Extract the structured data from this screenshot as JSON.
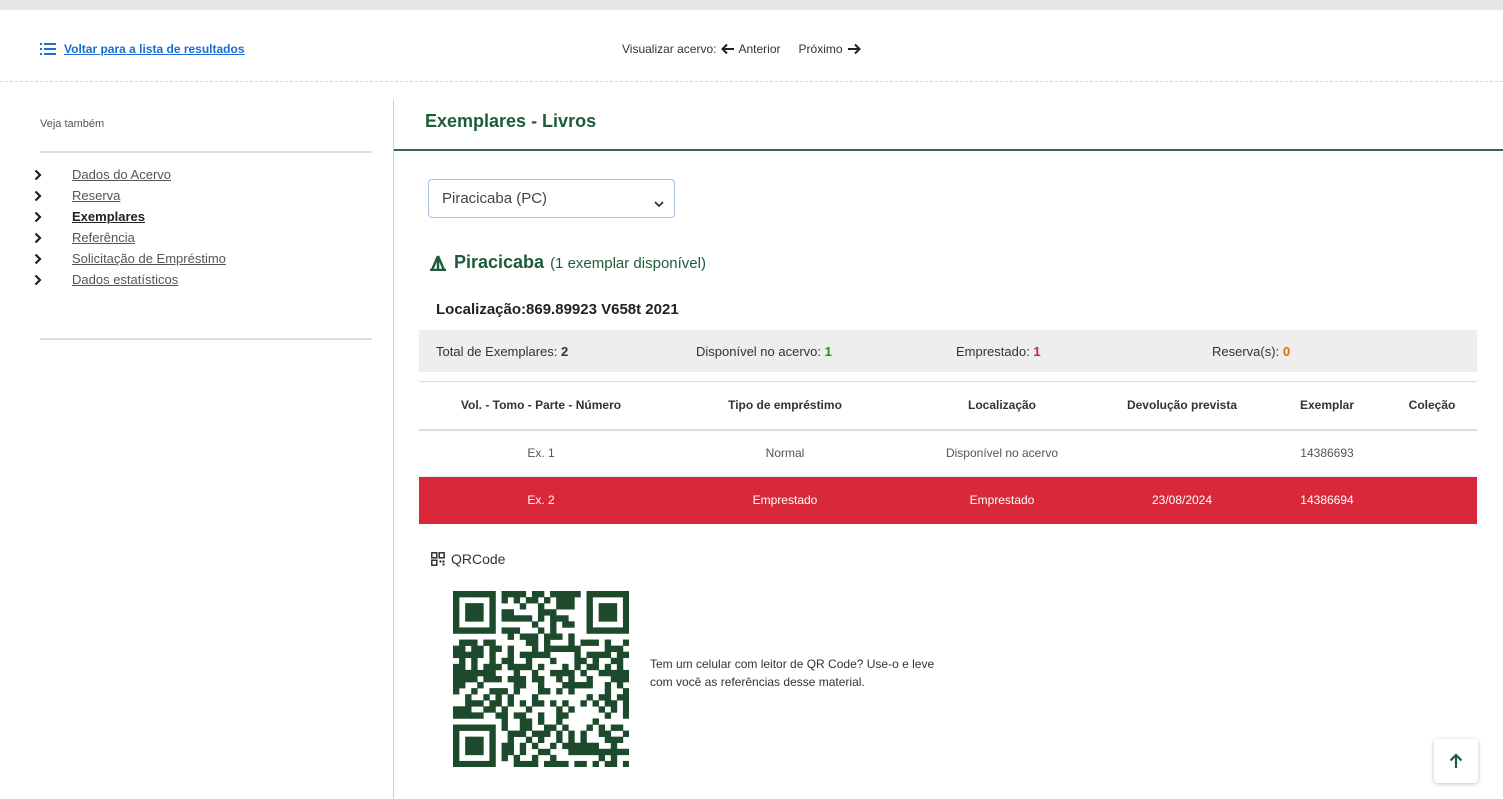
{
  "topbar": {
    "back_label": "Voltar para a lista de resultados",
    "view_label": "Visualizar acervo:",
    "prev_label": "Anterior",
    "next_label": "Próximo"
  },
  "sidebar": {
    "title": "Veja também",
    "items": [
      {
        "label": "Dados do Acervo",
        "active": false
      },
      {
        "label": "Reserva",
        "active": false
      },
      {
        "label": "Exemplares",
        "active": true
      },
      {
        "label": "Referência",
        "active": false
      },
      {
        "label": "Solicitação de Empréstimo",
        "active": false
      },
      {
        "label": "Dados estatísticos",
        "active": false
      }
    ]
  },
  "main": {
    "title": "Exemplares - Livros",
    "library_select": {
      "value": "Piracicaba (PC)"
    },
    "library": {
      "name": "Piracicaba",
      "availability": "(1 exemplar disponível)",
      "location": "Localização:869.89923 V658t 2021"
    },
    "summary": {
      "total_label": "Total de Exemplares:",
      "total_value": "2",
      "available_label": "Disponível no acervo:",
      "available_value": "1",
      "loaned_label": "Emprestado:",
      "loaned_value": "1",
      "reserve_label": "Reserva(s):",
      "reserve_value": "0"
    },
    "table": {
      "headers": [
        "Vol. - Tomo - Parte - Número",
        "Tipo de empréstimo",
        "Localização",
        "Devolução prevista",
        "Exemplar",
        "Coleção"
      ],
      "rows": [
        [
          "Ex. 1",
          "Normal",
          "Disponível no acervo",
          "",
          "14386693",
          ""
        ],
        [
          "Ex. 2",
          "Emprestado",
          "Emprestado",
          "23/08/2024",
          "14386694",
          ""
        ]
      ]
    },
    "qr": {
      "heading": "QRCode",
      "text": "Tem um celular com leitor de QR Code? Use-o e leve com você as referências desse material."
    }
  },
  "colors": {
    "brand_green": "#1e5b3a",
    "loaned_red": "#d9283a",
    "link_blue": "#1a6fd1",
    "available_green": "#2a8a2a",
    "reserve_orange": "#e36a00"
  },
  "icons": {
    "back": "list-icon",
    "prev": "arrow-left-icon",
    "next": "arrow-right-icon",
    "sidebar_bullet": "chevron-right-icon",
    "library": "library-icon",
    "qr": "qrcode-icon",
    "scroll_top": "arrow-up-icon"
  }
}
